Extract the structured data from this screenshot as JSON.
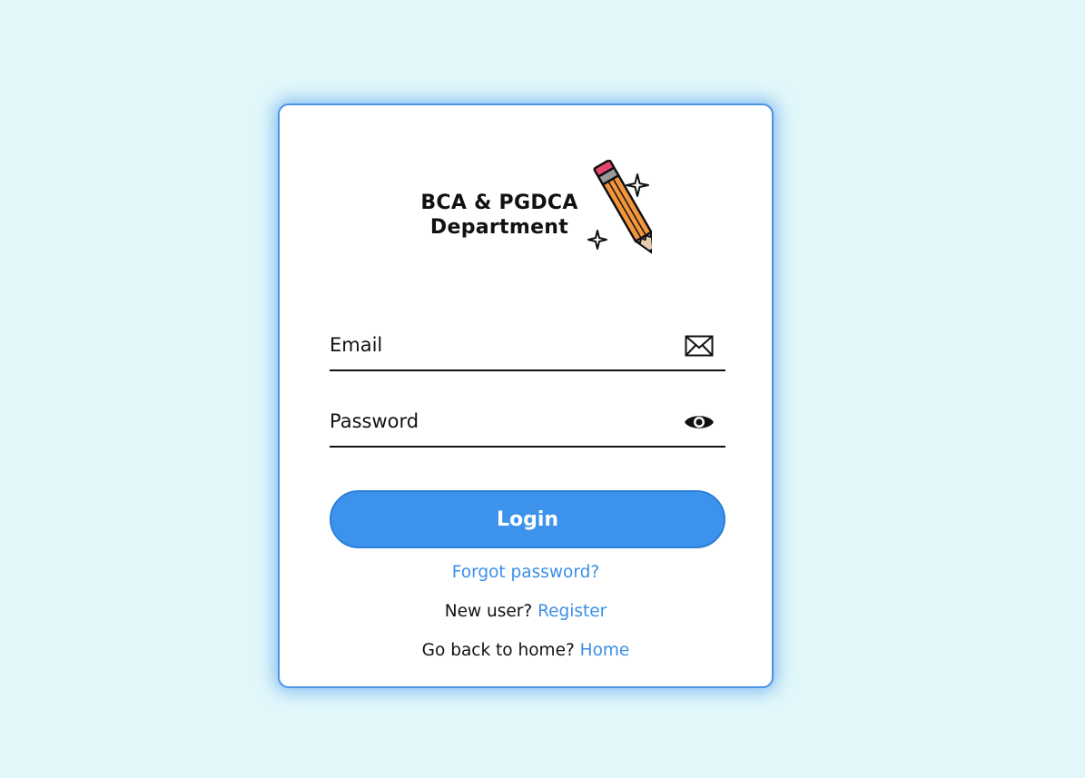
{
  "logo": {
    "line1": "BCA & PGDCA",
    "line2": "Department",
    "icon": "pencil-with-sparkles-icon"
  },
  "form": {
    "email": {
      "placeholder": "Email",
      "value": "",
      "icon": "envelope-icon"
    },
    "password": {
      "placeholder": "Password",
      "value": "",
      "icon": "eye-icon"
    },
    "login_label": "Login",
    "forgot_label": "Forgot password?",
    "register_prompt": "New user?",
    "register_label": "Register",
    "home_prompt": "Go back to home?",
    "home_label": "Home"
  },
  "colors": {
    "background": "#e1f7fa",
    "accent": "#3d93ec",
    "link": "#3b8fe6",
    "card_border": "#4a94e4"
  }
}
